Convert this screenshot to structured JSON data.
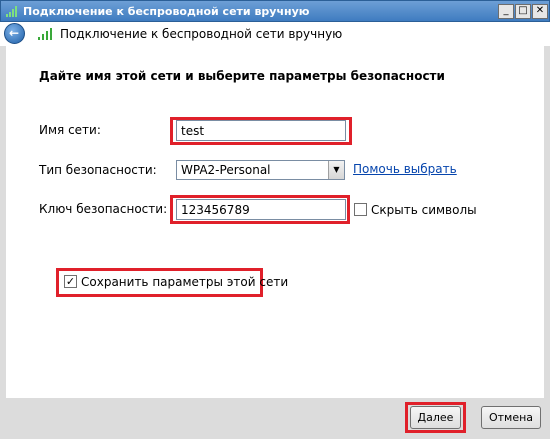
{
  "window": {
    "title": "Подключение к беспроводной сети вручную",
    "minimize_label": "_",
    "maximize_label": "□",
    "close_label": "✕"
  },
  "nav": {
    "back_icon": "back-arrow-icon",
    "title": "Подключение к беспроводной сети вручную"
  },
  "form": {
    "heading": "Дайте имя этой сети и выберите параметры безопасности",
    "network_name_label": "Имя сети:",
    "network_name_value": "test",
    "security_type_label": "Тип безопасности:",
    "security_type_value": "WPA2-Personal",
    "help_link": "Помочь выбрать",
    "security_key_label": "Ключ безопасности:",
    "security_key_value": "123456789",
    "hide_chars_label": "Скрыть символы",
    "hide_chars_checked": false,
    "save_settings_label": "Сохранить параметры этой сети",
    "save_settings_checked": true
  },
  "buttons": {
    "next_label": "Далее",
    "cancel_label": "Отмена"
  },
  "colors": {
    "highlight": "#e0202a",
    "titlebar": "#4a86c8",
    "link": "#0645ad"
  }
}
